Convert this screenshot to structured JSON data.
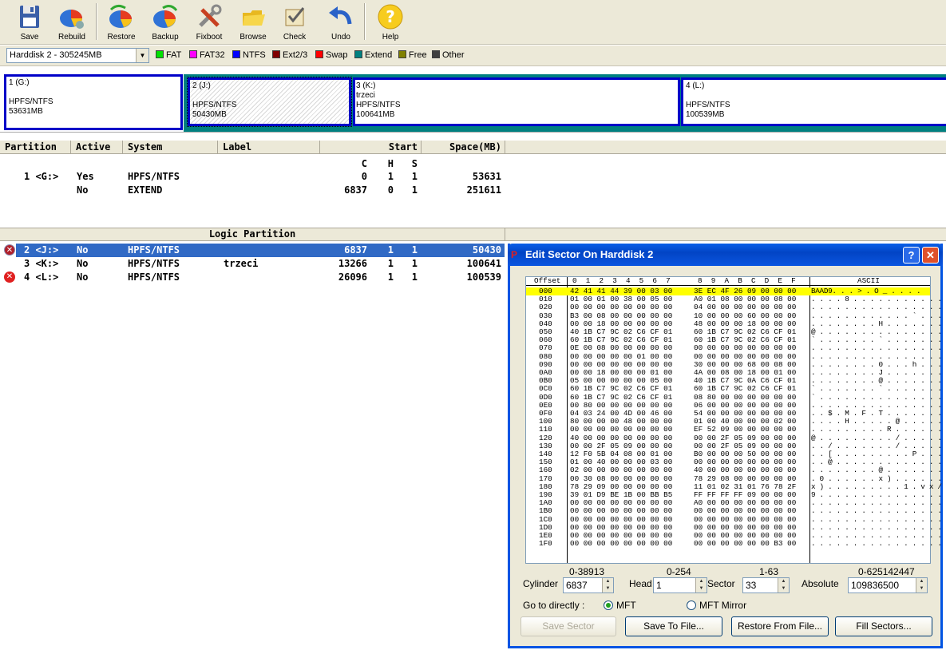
{
  "toolbar": {
    "buttons": [
      {
        "label": "Save",
        "icon": "floppy-disk-icon"
      },
      {
        "label": "Rebuild",
        "icon": "rebuild-pie-icon"
      },
      {
        "label": "Restore",
        "icon": "restore-pie-icon"
      },
      {
        "label": "Backup",
        "icon": "backup-pie-icon"
      },
      {
        "label": "Fixboot",
        "icon": "tools-icon"
      },
      {
        "label": "Browse",
        "icon": "folder-icon"
      },
      {
        "label": "Check",
        "icon": "check-icon"
      },
      {
        "label": "Undo",
        "icon": "undo-arrow-icon"
      },
      {
        "label": "Help",
        "icon": "help-icon"
      }
    ]
  },
  "disk_selector": {
    "value": "Harddisk 2 - 305245MB"
  },
  "legend": [
    {
      "label": "FAT",
      "color": "#00e000"
    },
    {
      "label": "FAT32",
      "color": "#ff00ff"
    },
    {
      "label": "NTFS",
      "color": "#0000ff"
    },
    {
      "label": "Ext2/3",
      "color": "#800000"
    },
    {
      "label": "Swap",
      "color": "#ff0000"
    },
    {
      "label": "Extend",
      "color": "#008080"
    },
    {
      "label": "Free",
      "color": "#808000"
    },
    {
      "label": "Other",
      "color": "#404040"
    }
  ],
  "partition_map": [
    {
      "line1": "1 (G:)",
      "line2": "",
      "line3": "HPFS/NTFS",
      "line4": "53631MB"
    },
    {
      "line1": "2 (J:)",
      "line2": "",
      "line3": "HPFS/NTFS",
      "line4": "50430MB"
    },
    {
      "line1": "3 (K:)",
      "line2": "trzeci",
      "line3": "HPFS/NTFS",
      "line4": "100641MB"
    },
    {
      "line1": "4 (L:)",
      "line2": "",
      "line3": "HPFS/NTFS",
      "line4": "100539MB"
    }
  ],
  "table": {
    "headers": {
      "partition": "Partition",
      "active": "Active",
      "system": "System",
      "label": "Label",
      "start": "Start",
      "space": "Space(MB)"
    },
    "chs": {
      "c": "C",
      "h": "H",
      "s": "S"
    },
    "primary": [
      {
        "part": "1 <G:>",
        "active": "Yes",
        "system": "HPFS/NTFS",
        "label": "",
        "c": "0",
        "h": "1",
        "s": "1",
        "space": "53631"
      },
      {
        "part": "",
        "active": "No",
        "system": "EXTEND",
        "label": "",
        "c": "6837",
        "h": "0",
        "s": "1",
        "space": "251611"
      }
    ],
    "logic_title": "Logic Partition",
    "logic": [
      {
        "part": "2 <J:>",
        "active": "No",
        "system": "HPFS/NTFS",
        "label": "",
        "c": "6837",
        "h": "1",
        "s": "1",
        "space": "50430"
      },
      {
        "part": "3 <K:>",
        "active": "No",
        "system": "HPFS/NTFS",
        "label": "trzeci",
        "c": "13266",
        "h": "1",
        "s": "1",
        "space": "100641"
      },
      {
        "part": "4 <L:>",
        "active": "No",
        "system": "HPFS/NTFS",
        "label": "",
        "c": "26096",
        "h": "1",
        "s": "1",
        "space": "100539"
      }
    ]
  },
  "dialog": {
    "title": "Edit Sector On Harddisk 2",
    "title_icon": "p-logo-icon",
    "hex": {
      "offset_header": "Offset",
      "col_header_a": "0  1  2  3  4  5  6  7",
      "col_header_b": "8  9  A  B  C  D  E  F",
      "ascii_header": "ASCII",
      "offsets": "000\n010\n020\n030\n040\n050\n060\n070\n080\n090\n0A0\n0B0\n0C0\n0D0\n0E0\n0F0\n100\n110\n120\n130\n140\n150\n160\n170\n180\n190\n1A0\n1B0\n1C0\n1D0\n1E0\n1F0",
      "bytes_a": "42 41 41 44 39 00 03 00\n01 00 01 00 38 00 05 00\n00 00 00 00 00 00 00 00\nB3 00 08 00 00 00 00 00\n00 00 18 00 00 00 00 00\n40 1B C7 9C 02 C6 CF 01\n60 1B C7 9C 02 C6 CF 01\n0E 00 08 00 00 00 00 00\n00 00 00 00 00 01 00 00\n00 00 00 00 00 00 00 00\n00 00 18 00 00 00 01 00\n05 00 00 00 00 00 05 00\n60 1B C7 9C 02 C6 CF 01\n60 1B C7 9C 02 C6 CF 01\n00 80 00 00 00 00 00 00\n04 03 24 00 4D 00 46 00\n80 00 00 00 48 00 00 00\n00 00 00 00 00 00 00 00\n40 00 00 00 00 00 00 00\n00 00 2F 05 09 00 00 00\n12 F0 5B 04 08 00 01 00\n01 00 40 00 00 00 03 00\n02 00 00 00 00 00 00 00\n00 30 08 00 00 00 00 00\n78 29 09 00 00 00 00 00\n39 01 D9 BE 1B 00 BB B5\n00 00 00 00 00 00 00 00\n00 00 00 00 00 00 00 00\n00 00 00 00 00 00 00 00\n00 00 00 00 00 00 00 00\n00 00 00 00 00 00 00 00\n00 00 00 00 00 00 00 00",
      "bytes_b": "3E EC 4F 26 09 00 00 00\nA0 01 08 00 00 00 08 00\n04 00 00 00 00 00 00 00\n10 00 00 00 60 00 00 00\n48 00 00 00 18 00 00 00\n60 1B C7 9C 02 C6 CF 01\n60 1B C7 9C 02 C6 CF 01\n00 00 00 00 00 00 00 00\n00 00 00 00 00 00 00 00\n30 00 00 00 68 00 08 00\n4A 00 08 00 18 00 01 00\n40 1B C7 9C 0A C6 CF 01\n60 1B C7 9C 02 C6 CF 01\n08 80 00 00 00 00 00 00\n06 00 00 00 00 00 00 00\n54 00 00 00 00 00 00 00\n01 00 40 00 00 00 02 00\nEF 52 09 00 00 00 00 00\n00 00 2F 05 09 00 00 00\n00 00 2F 05 09 00 00 00\nB0 00 00 00 50 00 00 00\n00 00 00 00 00 00 00 00\n40 00 00 00 00 00 00 00\n78 29 08 00 00 00 00 00\n11 01 02 31 01 76 78 2F\nFF FF FF FF 09 00 00 00\nA0 00 00 00 00 00 00 00\n00 00 00 00 00 00 00 00\n00 00 00 00 00 00 00 00\n00 00 00 00 00 00 00 00\n00 00 00 00 00 00 00 00\n00 00 00 00 00 00 B3 00",
      "ascii": "BAAD9. . . > . O _ . . . .\n. . . . 8 . . . . . . . . . . .\n. . . . . . . . . . . . . . . .\n. . . . . . . . . . . . ` . . .\n. . . . . . . . H . . . . . . .\n@ . . . . . . . . . . . . . . .\n` . . . . . . . ` . . . . . . .\n. . . . . . . . . . . . . . . .\n. . . . . . . . . . . . . . . .\n. . . . . . . . 0 . . . h . . .\n. . . . . . . . J . . . . . . .\n. . . . . . . . @ . . . . . . .\n` . . . . . . . ` . . . . . . .\n` . . . . . . . . . . . . . . .\n. . . . . . . . . . . . . . . .\n. . $ . M . F . T . . . . . . .\n. . . . H . . . . . @ . . . . .\n. . . . . . . . . R . . . . . .\n@ . . . . . . . . . / . . . . .\n. . / . . . . . . . / . . . . .\n. . [ . . . . . . . . . P . . .\n. . @ . . . . . . . . . . . . .\n. . . . . . . . @ . . . . . . .\n. 0 . . . . . . x ) . . . . . .\nx ) . . . . . . . . . 1 . v x /\n9 . . . . . . . . . . . . . . .\n. . . . . . . . . . . . . . . .\n. . . . . . . . . . . . . . . .\n. . . . . . . . . . . . . . . .\n. . . . . . . . . . . . . . . .\n. . . . . . . . . . . . . . . .\n. . . . . . . . . . . . . . . ."
    },
    "ranges": {
      "cylinder": "0-38913",
      "head": "0-254",
      "sector": "1-63",
      "absolute": "0-625142447"
    },
    "fields": {
      "cylinder_label": "Cylinder",
      "cylinder_value": "6837",
      "head_label": "Head",
      "head_value": "1",
      "sector_label": "Sector",
      "sector_value": "33",
      "absolute_label": "Absolute",
      "absolute_value": "109836500"
    },
    "goto_label": "Go to directly :",
    "radio_mft": "MFT",
    "radio_mft_mirror": "MFT Mirror",
    "buttons": {
      "save_sector": "Save Sector",
      "save_to_file": "Save To File...",
      "restore_from_file": "Restore From File...",
      "fill_sectors": "Fill Sectors..."
    }
  }
}
